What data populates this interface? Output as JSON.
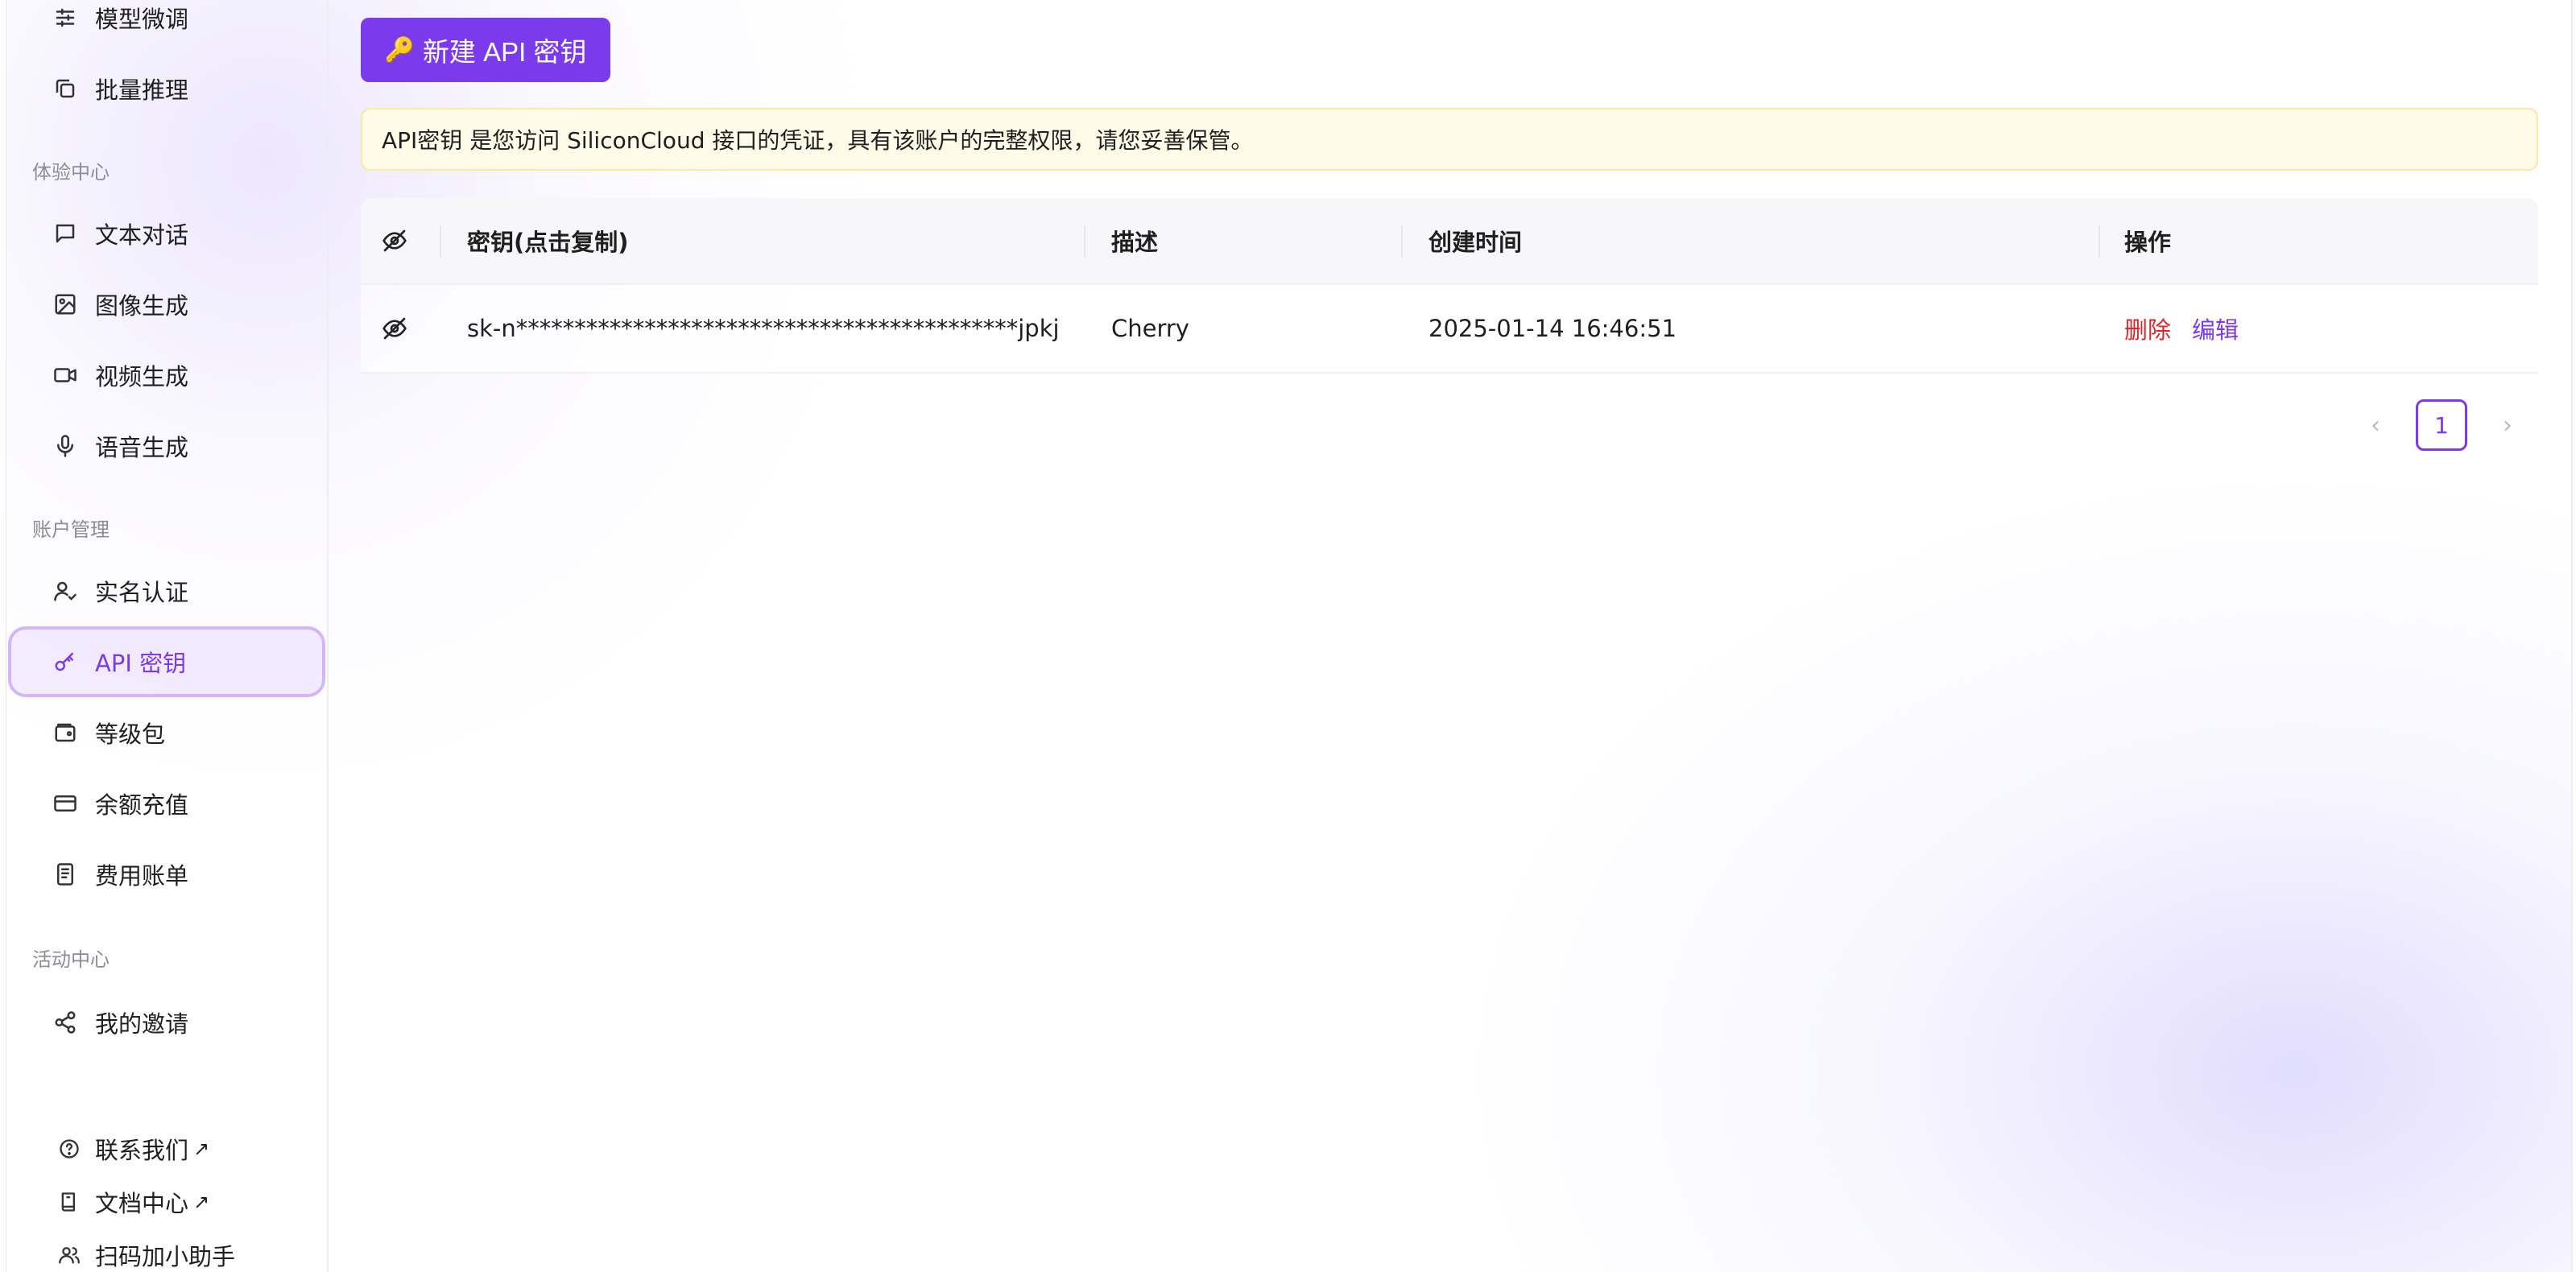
{
  "sidebar": {
    "items_top": [
      {
        "label": "模型微调",
        "icon": "sliders-icon"
      },
      {
        "label": "批量推理",
        "icon": "copy-icon"
      }
    ],
    "groups": [
      {
        "title": "体验中心",
        "items": [
          {
            "label": "文本对话",
            "icon": "chat-icon"
          },
          {
            "label": "图像生成",
            "icon": "image-icon"
          },
          {
            "label": "视频生成",
            "icon": "video-icon"
          },
          {
            "label": "语音生成",
            "icon": "mic-icon"
          }
        ]
      },
      {
        "title": "账户管理",
        "items": [
          {
            "label": "实名认证",
            "icon": "user-check-icon"
          },
          {
            "label": "API 密钥",
            "icon": "key-icon",
            "active": true
          },
          {
            "label": "等级包",
            "icon": "wallet-icon"
          },
          {
            "label": "余额充值",
            "icon": "credit-card-icon"
          },
          {
            "label": "费用账单",
            "icon": "receipt-icon"
          }
        ]
      },
      {
        "title": "活动中心",
        "items": [
          {
            "label": "我的邀请",
            "icon": "share-icon"
          }
        ]
      }
    ],
    "footer": [
      {
        "label": "联系我们",
        "icon": "help-circle-icon",
        "external": "↗"
      },
      {
        "label": "文档中心",
        "icon": "book-icon",
        "external": "↗"
      },
      {
        "label": "扫码加小助手",
        "icon": "users-icon"
      }
    ]
  },
  "main": {
    "new_key_button": {
      "emoji": "🔑",
      "label": "新建 API 密钥"
    },
    "notice": "API密钥 是您访问 SiliconCloud 接口的凭证，具有该账户的完整权限，请您妥善保管。",
    "table": {
      "headers": {
        "key": "密钥(点击复制)",
        "description": "描述",
        "created": "创建时间",
        "actions": "操作"
      },
      "rows": [
        {
          "key": "sk-n*******************************************jpkj",
          "description": "Cherry",
          "created": "2025-01-14 16:46:51",
          "delete": "删除",
          "edit": "编辑"
        }
      ]
    },
    "pagination": {
      "prev": "‹",
      "current": "1",
      "next": "›"
    }
  },
  "colors": {
    "accent": "#7c3aed",
    "danger": "#e0242a",
    "notice_bg": "#fefbe8"
  }
}
